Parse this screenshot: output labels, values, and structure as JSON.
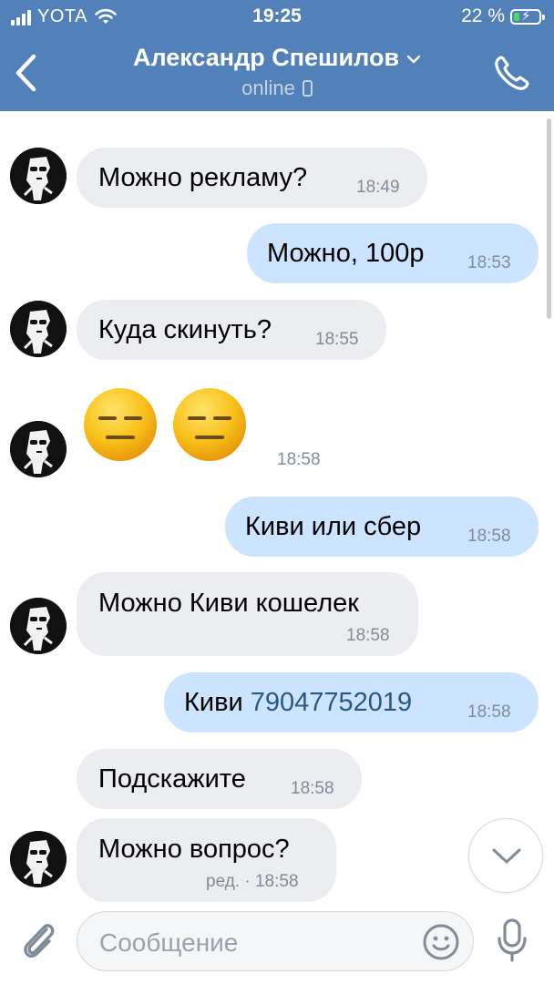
{
  "status_bar": {
    "carrier": "YOTA",
    "time": "19:25",
    "battery": "22 %",
    "battery_level": 0.22
  },
  "header": {
    "title": "Александр Спешилов",
    "subtitle": "online",
    "icons": {
      "back": "back-chevron-icon",
      "call": "phone-call-icon",
      "title_chevron": "chevron-down-icon",
      "device": "mobile-device-icon"
    }
  },
  "messages": [
    {
      "dir": "in",
      "text": "Можно рекламу?",
      "time": "18:49"
    },
    {
      "dir": "out",
      "text": "Можно, 100р",
      "time": "18:53"
    },
    {
      "dir": "in",
      "text": "Куда скинуть?",
      "time": "18:55"
    },
    {
      "dir": "in",
      "emoji": "expressionless-face-emoji",
      "count": 2,
      "time": "18:58"
    },
    {
      "dir": "out",
      "text": "Киви или сбер",
      "time": "18:58"
    },
    {
      "dir": "in",
      "text": "Можно Киви кошелек",
      "time": "18:58"
    },
    {
      "dir": "out",
      "text_prefix": "Киви",
      "link": "79047752019",
      "time": "18:58"
    },
    {
      "dir": "in",
      "text": "Подскажите",
      "time": "18:58"
    },
    {
      "dir": "in",
      "text": "Можно вопрос?",
      "edited": "ред.",
      "time": "18:58",
      "edited_time": "ред. · 18:58"
    }
  ],
  "composer": {
    "placeholder": "Сообщение",
    "icons": {
      "attach": "paperclip-icon",
      "emoji": "smile-icon",
      "voice": "microphone-icon",
      "scroll": "chevron-down-icon"
    }
  },
  "colors": {
    "header": "#5181b8",
    "incoming": "#ebedf0",
    "outgoing": "#cce4ff",
    "link": "#2a5885",
    "time": "#818c99"
  }
}
